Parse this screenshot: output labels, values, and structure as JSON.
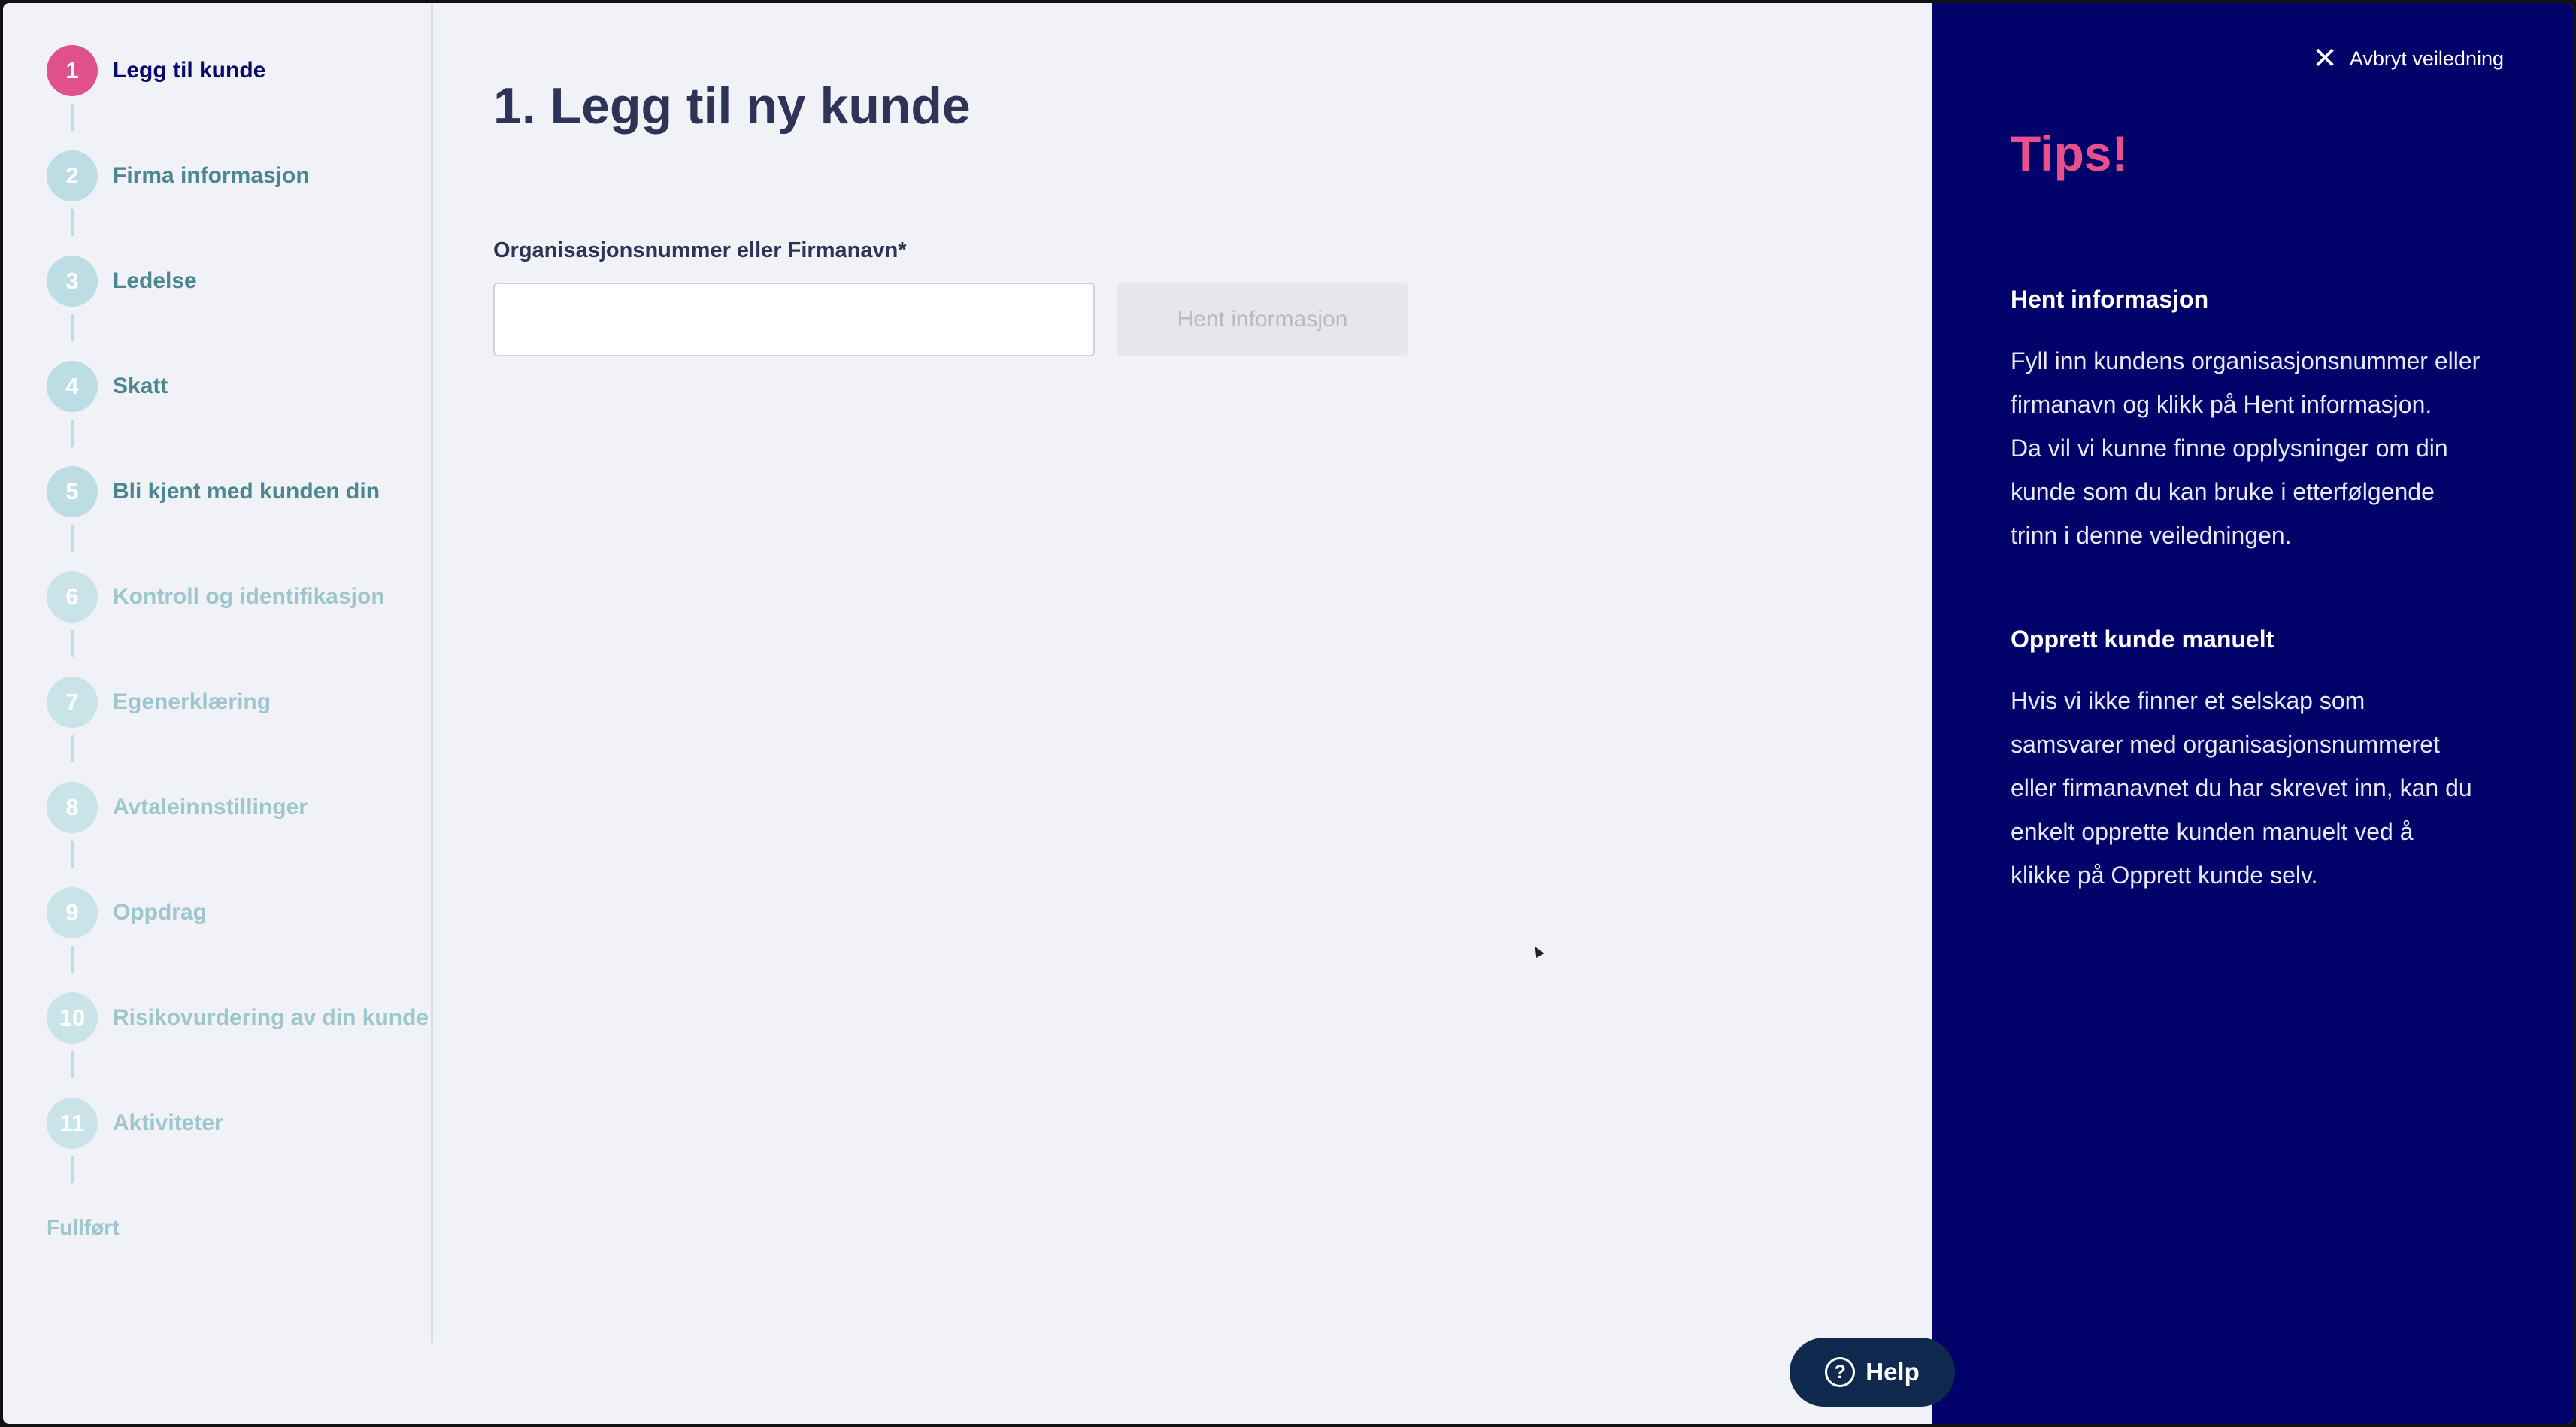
{
  "stepper": {
    "steps": [
      {
        "number": "1",
        "label": "Legg til kunde",
        "state": "active"
      },
      {
        "number": "2",
        "label": "Firma informasjon",
        "state": "pending"
      },
      {
        "number": "3",
        "label": "Ledelse",
        "state": "pending"
      },
      {
        "number": "4",
        "label": "Skatt",
        "state": "pending"
      },
      {
        "number": "5",
        "label": "Bli kjent med kunden din",
        "state": "pending"
      },
      {
        "number": "6",
        "label": "Kontroll og identifikasjon",
        "state": "muted"
      },
      {
        "number": "7",
        "label": "Egenerklæring",
        "state": "muted"
      },
      {
        "number": "8",
        "label": "Avtaleinnstillinger",
        "state": "muted"
      },
      {
        "number": "9",
        "label": "Oppdrag",
        "state": "muted"
      },
      {
        "number": "10",
        "label": "Risikovurdering av din kunde",
        "state": "muted"
      },
      {
        "number": "11",
        "label": "Aktiviteter",
        "state": "muted"
      }
    ],
    "done_label": "Fullført"
  },
  "main": {
    "title": "1. Legg til ny kunde",
    "field_label": "Organisasjonsnummer eller Firmanavn*",
    "input_value": "",
    "input_placeholder": "",
    "fetch_button": "Hent informasjon"
  },
  "help": {
    "label": "Help",
    "icon": "question-circle-icon"
  },
  "tips": {
    "cancel_label": "Avbryt veiledning",
    "cancel_icon": "close-icon",
    "title": "Tips!",
    "sections": [
      {
        "heading": "Hent informasjon",
        "lines": [
          "Fyll inn kundens organisasjonsnummer eller",
          "firmanavn og klikk på Hent informasjon.",
          "Da vil vi kunne finne opplysninger om din",
          "kunde som du kan bruke i etterfølgende",
          "trinn i denne veiledningen."
        ]
      },
      {
        "heading": "Opprett kunde manuelt",
        "lines": [
          "Hvis vi ikke finner et selskap som",
          "samsvarer med organisasjonsnummeret",
          "eller firmanavnet du har skrevet inn, kan du",
          "enkelt opprette kunden manuelt ved å",
          "klikke på Opprett kunde selv."
        ]
      }
    ]
  },
  "colors": {
    "accent_pink": "#e0508c",
    "panel_navy": "#02026b",
    "step_teal": "#bcdde3",
    "title_dark": "#2f3457"
  }
}
